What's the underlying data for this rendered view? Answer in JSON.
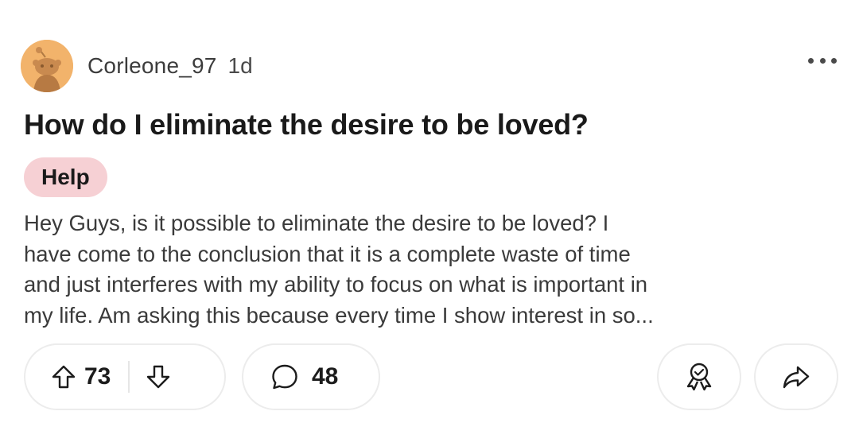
{
  "post": {
    "author": "Corleone_97",
    "age": "1d",
    "title": "How do I eliminate the desire to be loved?",
    "flair": "Help",
    "body_lines": [
      "Hey Guys, is it possible to eliminate the desire to be loved? I",
      "have come to the conclusion that it is a complete waste of time",
      "and just interferes with my ability to focus on what is important in",
      "my life. Am asking this because every time I show interest in so..."
    ],
    "votes": "73",
    "comments": "48"
  },
  "icons": {
    "avatar": "snoo-avatar",
    "more": "more-horizontal-icon",
    "upvote": "upvote-arrow-icon",
    "downvote": "downvote-arrow-icon",
    "comment": "speech-bubble-icon",
    "award": "award-ribbon-icon",
    "share": "share-arrow-icon"
  },
  "colors": {
    "avatar_bg": "#f2b36b",
    "flair_bg": "#f6d0d4",
    "pill_border": "#ececec",
    "text_primary": "#1a1a1a",
    "text_body": "#3a3a3a"
  }
}
